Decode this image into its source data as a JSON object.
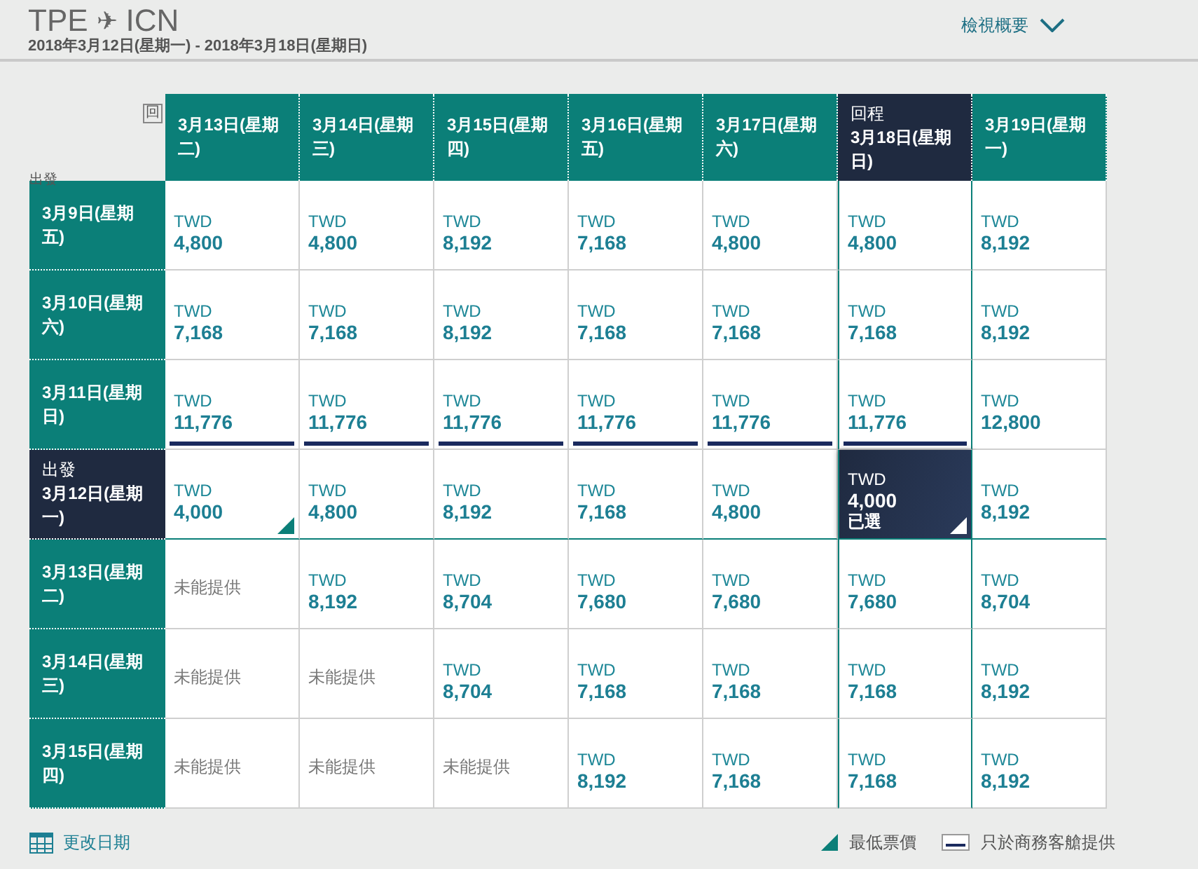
{
  "header": {
    "origin": "TPE",
    "arrow": "✈",
    "destination": "ICN",
    "dates": "2018年3月12日(星期一) - 2018年3月18日(星期日)",
    "summary_link": "檢視概要"
  },
  "corner": {
    "return_label": "回",
    "depart_label": "出發"
  },
  "columns": [
    {
      "label": "3月13日(星期二)",
      "selected": false
    },
    {
      "label": "3月14日(星期三)",
      "selected": false
    },
    {
      "label": "3月15日(星期四)",
      "selected": false
    },
    {
      "label": "3月16日(星期五)",
      "selected": false
    },
    {
      "label": "3月17日(星期六)",
      "selected": false
    },
    {
      "label": "3月18日(星期日)",
      "selected": true,
      "tag": "回程"
    },
    {
      "label": "3月19日(星期一)",
      "selected": false
    }
  ],
  "rows": [
    {
      "label": "3月9日(星期五)",
      "selected": false,
      "cells": [
        {
          "kind": "fare",
          "currency": "TWD",
          "price": "4,800",
          "business_only": false,
          "lowest": false,
          "selected": false
        },
        {
          "kind": "fare",
          "currency": "TWD",
          "price": "4,800",
          "business_only": false,
          "lowest": false,
          "selected": false
        },
        {
          "kind": "fare",
          "currency": "TWD",
          "price": "8,192",
          "business_only": false,
          "lowest": false,
          "selected": false
        },
        {
          "kind": "fare",
          "currency": "TWD",
          "price": "7,168",
          "business_only": false,
          "lowest": false,
          "selected": false
        },
        {
          "kind": "fare",
          "currency": "TWD",
          "price": "4,800",
          "business_only": false,
          "lowest": false,
          "selected": false
        },
        {
          "kind": "fare",
          "currency": "TWD",
          "price": "4,800",
          "business_only": false,
          "lowest": false,
          "selected": false
        },
        {
          "kind": "fare",
          "currency": "TWD",
          "price": "8,192",
          "business_only": false,
          "lowest": false,
          "selected": false
        }
      ]
    },
    {
      "label": "3月10日(星期六)",
      "selected": false,
      "cells": [
        {
          "kind": "fare",
          "currency": "TWD",
          "price": "7,168",
          "business_only": false,
          "lowest": false,
          "selected": false
        },
        {
          "kind": "fare",
          "currency": "TWD",
          "price": "7,168",
          "business_only": false,
          "lowest": false,
          "selected": false
        },
        {
          "kind": "fare",
          "currency": "TWD",
          "price": "8,192",
          "business_only": false,
          "lowest": false,
          "selected": false
        },
        {
          "kind": "fare",
          "currency": "TWD",
          "price": "7,168",
          "business_only": false,
          "lowest": false,
          "selected": false
        },
        {
          "kind": "fare",
          "currency": "TWD",
          "price": "7,168",
          "business_only": false,
          "lowest": false,
          "selected": false
        },
        {
          "kind": "fare",
          "currency": "TWD",
          "price": "7,168",
          "business_only": false,
          "lowest": false,
          "selected": false
        },
        {
          "kind": "fare",
          "currency": "TWD",
          "price": "8,192",
          "business_only": false,
          "lowest": false,
          "selected": false
        }
      ]
    },
    {
      "label": "3月11日(星期日)",
      "selected": false,
      "cells": [
        {
          "kind": "fare",
          "currency": "TWD",
          "price": "11,776",
          "business_only": true,
          "lowest": false,
          "selected": false
        },
        {
          "kind": "fare",
          "currency": "TWD",
          "price": "11,776",
          "business_only": true,
          "lowest": false,
          "selected": false
        },
        {
          "kind": "fare",
          "currency": "TWD",
          "price": "11,776",
          "business_only": true,
          "lowest": false,
          "selected": false
        },
        {
          "kind": "fare",
          "currency": "TWD",
          "price": "11,776",
          "business_only": true,
          "lowest": false,
          "selected": false
        },
        {
          "kind": "fare",
          "currency": "TWD",
          "price": "11,776",
          "business_only": true,
          "lowest": false,
          "selected": false
        },
        {
          "kind": "fare",
          "currency": "TWD",
          "price": "11,776",
          "business_only": true,
          "lowest": false,
          "selected": false
        },
        {
          "kind": "fare",
          "currency": "TWD",
          "price": "12,800",
          "business_only": false,
          "lowest": false,
          "selected": false
        }
      ]
    },
    {
      "label": "3月12日(星期一)",
      "selected": true,
      "tag": "出發",
      "cells": [
        {
          "kind": "fare",
          "currency": "TWD",
          "price": "4,000",
          "business_only": false,
          "lowest": true,
          "selected": false
        },
        {
          "kind": "fare",
          "currency": "TWD",
          "price": "4,800",
          "business_only": false,
          "lowest": false,
          "selected": false
        },
        {
          "kind": "fare",
          "currency": "TWD",
          "price": "8,192",
          "business_only": false,
          "lowest": false,
          "selected": false
        },
        {
          "kind": "fare",
          "currency": "TWD",
          "price": "7,168",
          "business_only": false,
          "lowest": false,
          "selected": false
        },
        {
          "kind": "fare",
          "currency": "TWD",
          "price": "4,800",
          "business_only": false,
          "lowest": false,
          "selected": false
        },
        {
          "kind": "fare",
          "currency": "TWD",
          "price": "4,000",
          "business_only": false,
          "lowest": true,
          "selected": true,
          "status": "已選"
        },
        {
          "kind": "fare",
          "currency": "TWD",
          "price": "8,192",
          "business_only": false,
          "lowest": false,
          "selected": false
        }
      ]
    },
    {
      "label": "3月13日(星期二)",
      "selected": false,
      "cells": [
        {
          "kind": "unavailable",
          "text": "未能提供"
        },
        {
          "kind": "fare",
          "currency": "TWD",
          "price": "8,192",
          "business_only": false,
          "lowest": false,
          "selected": false
        },
        {
          "kind": "fare",
          "currency": "TWD",
          "price": "8,704",
          "business_only": false,
          "lowest": false,
          "selected": false
        },
        {
          "kind": "fare",
          "currency": "TWD",
          "price": "7,680",
          "business_only": false,
          "lowest": false,
          "selected": false
        },
        {
          "kind": "fare",
          "currency": "TWD",
          "price": "7,680",
          "business_only": false,
          "lowest": false,
          "selected": false
        },
        {
          "kind": "fare",
          "currency": "TWD",
          "price": "7,680",
          "business_only": false,
          "lowest": false,
          "selected": false
        },
        {
          "kind": "fare",
          "currency": "TWD",
          "price": "8,704",
          "business_only": false,
          "lowest": false,
          "selected": false
        }
      ]
    },
    {
      "label": "3月14日(星期三)",
      "selected": false,
      "cells": [
        {
          "kind": "unavailable",
          "text": "未能提供"
        },
        {
          "kind": "unavailable",
          "text": "未能提供"
        },
        {
          "kind": "fare",
          "currency": "TWD",
          "price": "8,704",
          "business_only": false,
          "lowest": false,
          "selected": false
        },
        {
          "kind": "fare",
          "currency": "TWD",
          "price": "7,168",
          "business_only": false,
          "lowest": false,
          "selected": false
        },
        {
          "kind": "fare",
          "currency": "TWD",
          "price": "7,168",
          "business_only": false,
          "lowest": false,
          "selected": false
        },
        {
          "kind": "fare",
          "currency": "TWD",
          "price": "7,168",
          "business_only": false,
          "lowest": false,
          "selected": false
        },
        {
          "kind": "fare",
          "currency": "TWD",
          "price": "8,192",
          "business_only": false,
          "lowest": false,
          "selected": false
        }
      ]
    },
    {
      "label": "3月15日(星期四)",
      "selected": false,
      "cells": [
        {
          "kind": "unavailable",
          "text": "未能提供"
        },
        {
          "kind": "unavailable",
          "text": "未能提供"
        },
        {
          "kind": "unavailable",
          "text": "未能提供"
        },
        {
          "kind": "fare",
          "currency": "TWD",
          "price": "8,192",
          "business_only": false,
          "lowest": false,
          "selected": false
        },
        {
          "kind": "fare",
          "currency": "TWD",
          "price": "7,168",
          "business_only": false,
          "lowest": false,
          "selected": false
        },
        {
          "kind": "fare",
          "currency": "TWD",
          "price": "7,168",
          "business_only": false,
          "lowest": false,
          "selected": false
        },
        {
          "kind": "fare",
          "currency": "TWD",
          "price": "8,192",
          "business_only": false,
          "lowest": false,
          "selected": false
        }
      ]
    }
  ],
  "footer": {
    "change_dates": "更改日期",
    "legend": [
      {
        "kind": "lowest",
        "label": "最低票價"
      },
      {
        "kind": "business",
        "label": "只於商務客艙提供"
      }
    ]
  }
}
